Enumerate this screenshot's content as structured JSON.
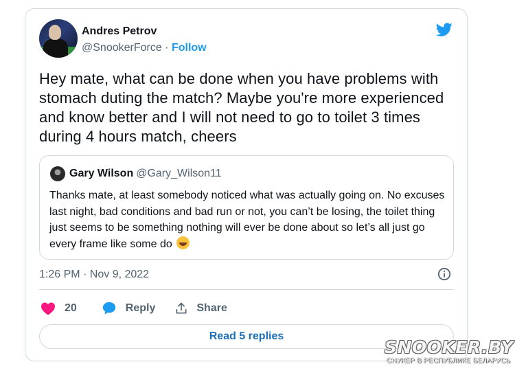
{
  "tweet": {
    "author_name": "Andres Petrov",
    "author_handle": "@SnookerForce",
    "separator": " · ",
    "follow_label": "Follow",
    "text": "Hey mate, what can be done when you have problems with stomach duting the match? Maybe you're more experienced and know better and I will not need to go to toilet 3 times during 4 hours match, cheers",
    "timestamp": "1:26 PM · Nov 9, 2022"
  },
  "quoted_tweet": {
    "author_name": "Gary Wilson",
    "author_handle": "@Gary_Wilson11",
    "text": "Thanks mate, at least somebody noticed what was actually going on. No excuses last night, bad conditions and bad run or not, you can’t be losing, the toilet thing just seems to be something nothing will ever be done about so let’s all just go every frame like some do"
  },
  "actions": {
    "like_count": "20",
    "reply_label": "Reply",
    "share_label": "Share",
    "read_replies_label": "Read 5 replies"
  },
  "watermark": {
    "title": "SNOOKER.BY",
    "subtitle": "СНУКЕР В РЕСПУБЛИКЕ БЕЛАРУСЬ"
  },
  "icons": {
    "brand": "twitter-bird-icon",
    "info": "info-icon",
    "like": "heart-icon",
    "reply": "speech-bubble-icon",
    "share": "share-upload-icon",
    "emoji": "rolling-on-floor-laughing-emoji"
  },
  "colors": {
    "twitter_blue": "#1d9bf0",
    "like_pink": "#f91880",
    "text_gray": "#536471",
    "border": "#cfd9de"
  }
}
